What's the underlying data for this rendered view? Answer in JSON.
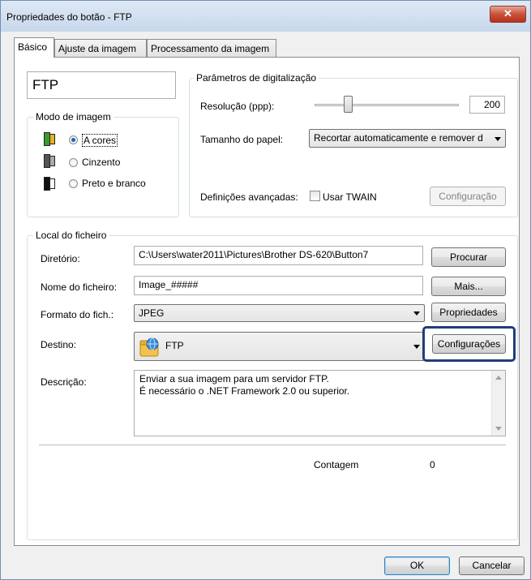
{
  "window": {
    "title": "Propriedades do botão - FTP",
    "close_glyph": "✕"
  },
  "tabs": [
    {
      "label": "Básico",
      "active": true
    },
    {
      "label": "Ajuste da imagem",
      "active": false
    },
    {
      "label": "Processamento da imagem",
      "active": false
    }
  ],
  "button_name": "FTP",
  "image_mode": {
    "legend": "Modo de imagem",
    "options": [
      {
        "label": "A cores",
        "selected": true,
        "icon": "color-mode-icon"
      },
      {
        "label": "Cinzento",
        "selected": false,
        "icon": "gray-mode-icon"
      },
      {
        "label": "Preto e branco",
        "selected": false,
        "icon": "bw-mode-icon"
      }
    ]
  },
  "scan_params": {
    "legend": "Parâmetros de digitalização",
    "resolution_label": "Resolução (ppp):",
    "resolution_value": "200",
    "resolution_slider_fraction": 0.27,
    "paper_label": "Tamanho do papel:",
    "paper_value": "Recortar automaticamente e remover d",
    "advanced_label": "Definições avançadas:",
    "twain_label": "Usar TWAIN",
    "twain_checked": false,
    "config_button": "Configuração"
  },
  "file_location": {
    "legend": "Local do ficheiro",
    "dir_label": "Diretório:",
    "dir_value": "C:\\Users\\water2011\\Pictures\\Brother DS-620\\Button7",
    "browse_button": "Procurar",
    "filename_label": "Nome do ficheiro:",
    "filename_value": "Image_#####",
    "more_button": "Mais...",
    "format_label": "Formato do fich.:",
    "format_value": "JPEG",
    "properties_button": "Propriedades",
    "dest_label": "Destino:",
    "dest_value": "FTP",
    "dest_icon": "ftp-folder-icon",
    "settings_button": "Configurações",
    "desc_label": "Descrição:",
    "desc_line1": "Enviar a sua imagem para um servidor FTP.",
    "desc_line2": "É necessário o .NET Framework 2.0 ou superior.",
    "count_label": "Contagem",
    "count_value": "0"
  },
  "footer": {
    "ok": "OK",
    "cancel": "Cancelar"
  },
  "colors": {
    "highlight": "#1f3d7a",
    "radio_selected": "#1b5fc4",
    "close_red": "#c9523a"
  }
}
